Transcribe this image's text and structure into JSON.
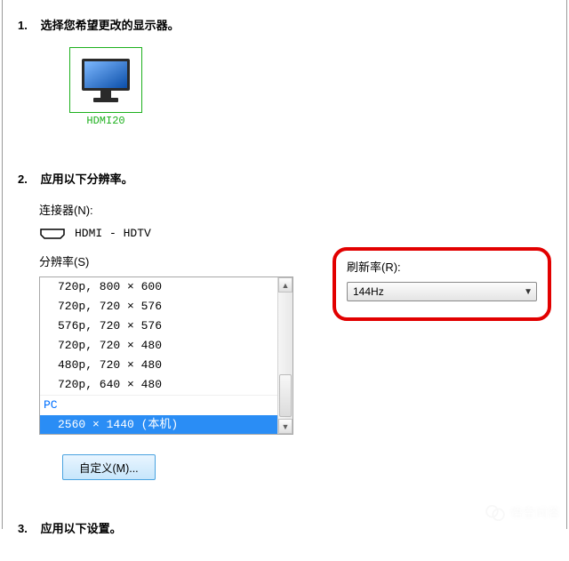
{
  "step1": {
    "num": "1.",
    "title": "选择您希望更改的显示器。",
    "monitor_label": "HDMI20"
  },
  "step2": {
    "num": "2.",
    "title": "应用以下分辨率。",
    "connector_label": "连接器(N):",
    "connector_value": "HDMI - HDTV",
    "resolution_label": "分辨率(S)",
    "resolutions": [
      "720p, 800 × 600",
      "720p, 720 × 576",
      "576p, 720 × 576",
      "720p, 720 × 480",
      "480p, 720 × 480",
      "720p, 640 × 480"
    ],
    "group_label": "PC",
    "selected_resolution": "2560 × 1440 (本机)",
    "refresh_label": "刷新率(R):",
    "refresh_value": "144Hz",
    "custom_button": "自定义(M)..."
  },
  "step3": {
    "num": "3.",
    "title": "应用以下设置。"
  },
  "watermark": "悟空问答"
}
